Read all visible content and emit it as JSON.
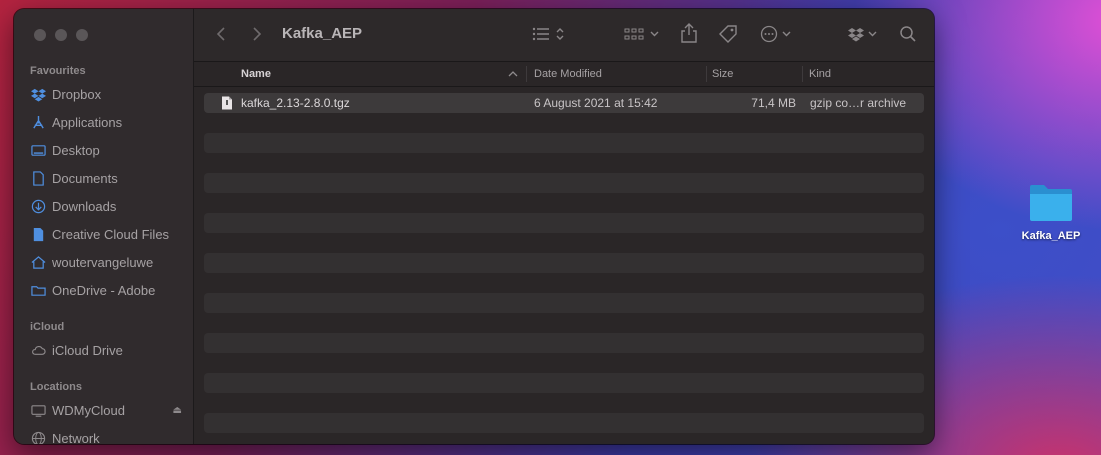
{
  "window": {
    "title": "Kafka_AEP"
  },
  "sidebar": {
    "sections": {
      "favourites": "Favourites",
      "icloud": "iCloud",
      "locations": "Locations"
    },
    "items": [
      {
        "label": "Dropbox",
        "icon": "dropbox-icon"
      },
      {
        "label": "Applications",
        "icon": "applications-icon"
      },
      {
        "label": "Desktop",
        "icon": "desktop-icon"
      },
      {
        "label": "Documents",
        "icon": "document-icon"
      },
      {
        "label": "Downloads",
        "icon": "download-icon"
      },
      {
        "label": "Creative Cloud Files",
        "icon": "file-icon"
      },
      {
        "label": "woutervangeluwe",
        "icon": "home-icon"
      },
      {
        "label": "OneDrive - Adobe",
        "icon": "folder-icon"
      },
      {
        "label": "iCloud Drive",
        "icon": "cloud-icon"
      },
      {
        "label": "WDMyCloud",
        "icon": "display-icon"
      },
      {
        "label": "Network",
        "icon": "network-icon"
      }
    ],
    "eject": "⏏"
  },
  "columns": {
    "name": "Name",
    "date": "Date Modified",
    "size": "Size",
    "kind": "Kind"
  },
  "files": [
    {
      "name": "kafka_2.13-2.8.0.tgz",
      "date": "6 August 2021 at 15:42",
      "size": "71,4 MB",
      "kind": "gzip co…r archive"
    }
  ],
  "desktop": {
    "folder_label": "Kafka_AEP"
  },
  "colors": {
    "folder": "#3ab0ec",
    "window_bg": "#2a2627"
  }
}
